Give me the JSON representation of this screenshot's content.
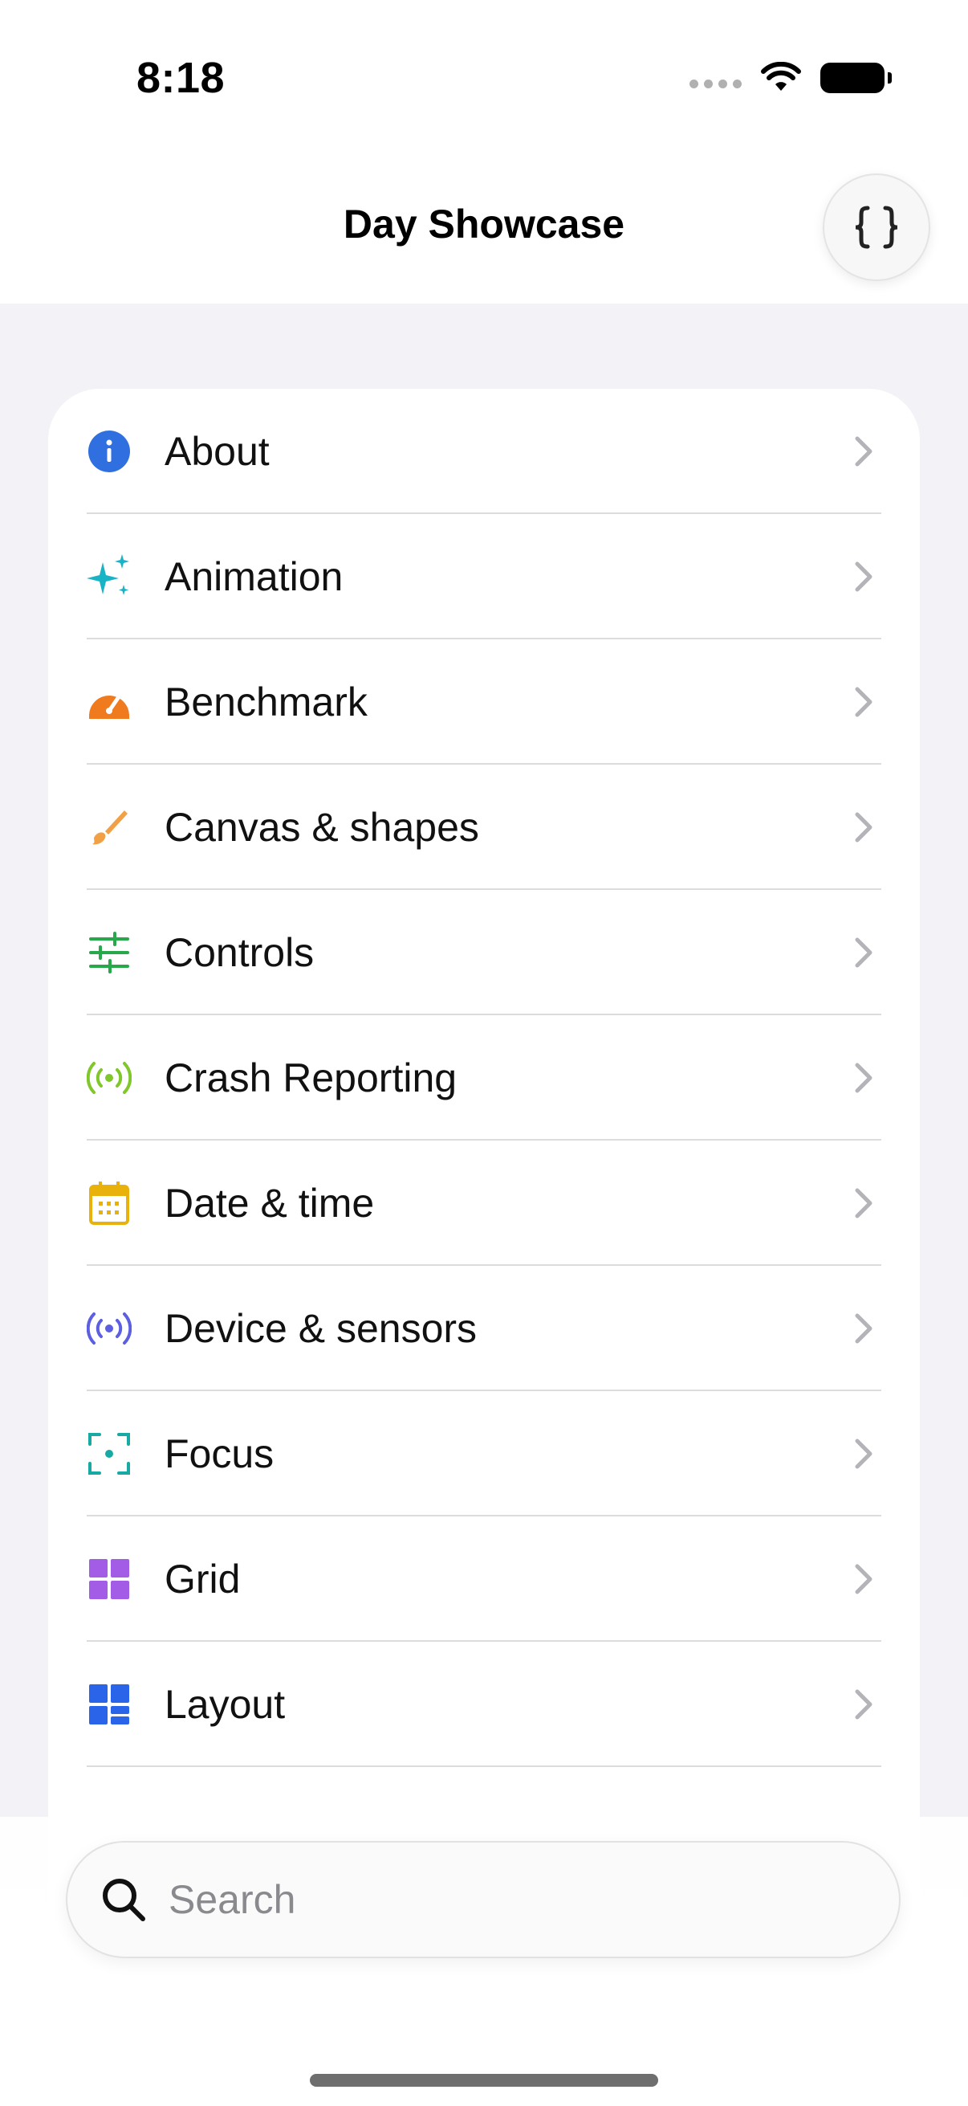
{
  "status_bar": {
    "time": "8:18"
  },
  "nav": {
    "title": "Day Showcase",
    "code_button_icon": "curly-braces-icon"
  },
  "list": {
    "items": [
      {
        "label": "About",
        "icon": "info-icon",
        "color": "#2f6fe0"
      },
      {
        "label": "Animation",
        "icon": "sparkles-icon",
        "color": "#19b3c6"
      },
      {
        "label": "Benchmark",
        "icon": "gauge-icon",
        "color": "#f07a1e"
      },
      {
        "label": "Canvas & shapes",
        "icon": "paintbrush-icon",
        "color": "#f2a046"
      },
      {
        "label": "Controls",
        "icon": "sliders-icon",
        "color": "#27a84a"
      },
      {
        "label": "Crash Reporting",
        "icon": "broadcast-icon",
        "color": "#7fc72a"
      },
      {
        "label": "Date & time",
        "icon": "calendar-icon",
        "color": "#e9b10c"
      },
      {
        "label": "Device & sensors",
        "icon": "sensor-icon",
        "color": "#5b5fe0"
      },
      {
        "label": "Focus",
        "icon": "focus-icon",
        "color": "#17a9a4"
      },
      {
        "label": "Grid",
        "icon": "grid-icon",
        "color": "#a35ce6"
      },
      {
        "label": "Layout",
        "icon": "layout-icon",
        "color": "#2a64e8"
      }
    ]
  },
  "search": {
    "placeholder": "Search",
    "icon": "magnifier-icon"
  }
}
